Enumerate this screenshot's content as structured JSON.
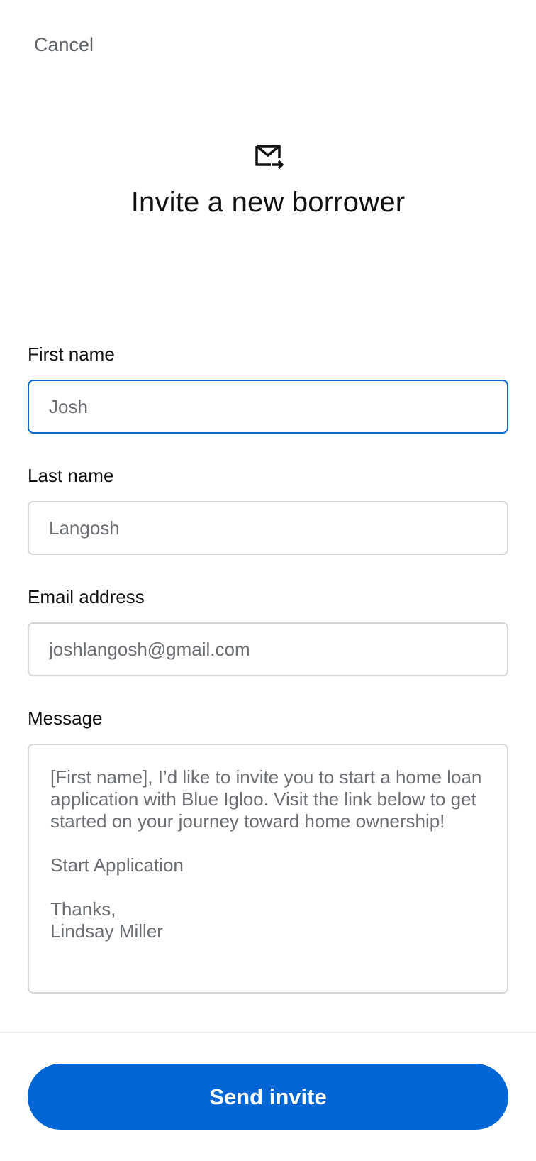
{
  "header": {
    "cancel_label": "Cancel",
    "icon": "mail-send-icon",
    "title": "Invite a new borrower"
  },
  "form": {
    "first_name": {
      "label": "First name",
      "value": "Josh",
      "focused": true
    },
    "last_name": {
      "label": "Last name",
      "value": "Langosh"
    },
    "email": {
      "label": "Email address",
      "value": "joshlangosh@gmail.com"
    },
    "message": {
      "label": "Message",
      "value": "[First name], I’d like to invite you to start a home loan application with Blue Igloo. Visit the link below to get started on your journey toward home ownership!\n\nStart Application\n\nThanks,\nLindsay Miller"
    }
  },
  "footer": {
    "send_label": "Send invite"
  },
  "colors": {
    "accent": "#0066d6",
    "focus_border": "#0a66d1",
    "input_border": "#d4d6d9",
    "muted_text": "#6b6f74"
  }
}
